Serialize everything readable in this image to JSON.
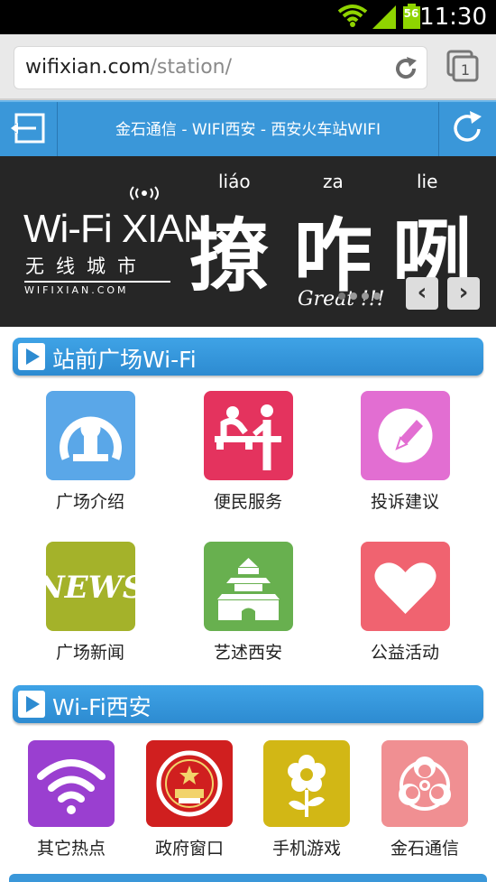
{
  "status_bar": {
    "time": "11:30",
    "battery_level": "56"
  },
  "browser": {
    "url_host": "wifixian.com",
    "url_path": "/station/"
  },
  "nav": {
    "title": "金石通信 - WIFI西安 - 西安火车站WIFI"
  },
  "banner": {
    "logo_text": "Wi-Fi XIAN",
    "logo_cn": "无线城市",
    "logo_url": "WIFIXIAN.COM",
    "pinyin": [
      "liáo",
      "za",
      "lie"
    ],
    "characters": [
      "撩",
      "咋",
      "咧"
    ],
    "tagline": "Great !!!",
    "prev_label": "‹",
    "next_label": "›"
  },
  "sections": [
    {
      "title": "站前广场Wi-Fi",
      "items": [
        {
          "label": "广场介绍",
          "icon": "railway-logo-icon",
          "color": "#5aa7e8"
        },
        {
          "label": "便民服务",
          "icon": "service-desk-icon",
          "color": "#e4335e"
        },
        {
          "label": "投诉建议",
          "icon": "pen-edit-icon",
          "color": "#e26ed2"
        },
        {
          "label": "广场新闻",
          "icon": "news-icon",
          "color": "#a4b22a"
        },
        {
          "label": "艺述西安",
          "icon": "bell-tower-icon",
          "color": "#68b04f"
        },
        {
          "label": "公益活动",
          "icon": "heart-icon",
          "color": "#f06370"
        }
      ]
    },
    {
      "title": "Wi-Fi西安",
      "items": [
        {
          "label": "其它热点",
          "icon": "wifi-icon",
          "color": "#9a3fd0"
        },
        {
          "label": "政府窗口",
          "icon": "national-emblem-icon",
          "color": "#d01f1f"
        },
        {
          "label": "手机游戏",
          "icon": "flower-icon",
          "color": "#d2b715"
        },
        {
          "label": "金石通信",
          "icon": "biohazard-icon",
          "color": "#f08f92"
        }
      ]
    }
  ]
}
